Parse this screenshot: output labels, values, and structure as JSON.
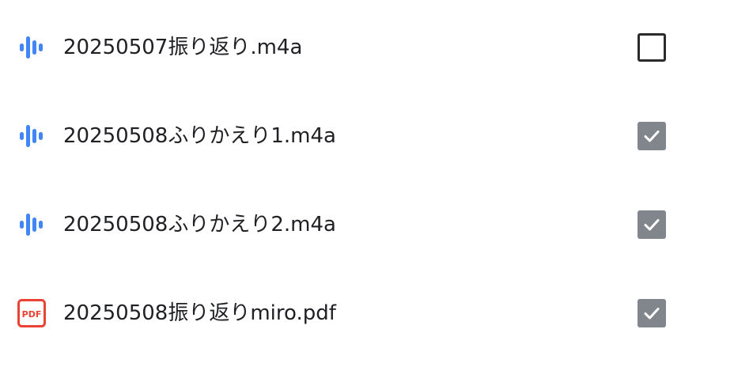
{
  "colors": {
    "audio_icon": "#4285f4",
    "pdf_icon": "#ea4335",
    "checkbox_checked": "#80868b",
    "checkbox_border": "#2b2b2b"
  },
  "files": [
    {
      "name": "20250507振り返り.m4a",
      "icon": "audio-waveform-icon",
      "checked": false
    },
    {
      "name": "20250508ふりかえり1.m4a",
      "icon": "audio-waveform-icon",
      "checked": true
    },
    {
      "name": "20250508ふりかえり2.m4a",
      "icon": "audio-waveform-icon",
      "checked": true
    },
    {
      "name": "20250508振り返りmiro.pdf",
      "icon": "pdf-icon",
      "pdf_label": "PDF",
      "checked": true
    }
  ]
}
